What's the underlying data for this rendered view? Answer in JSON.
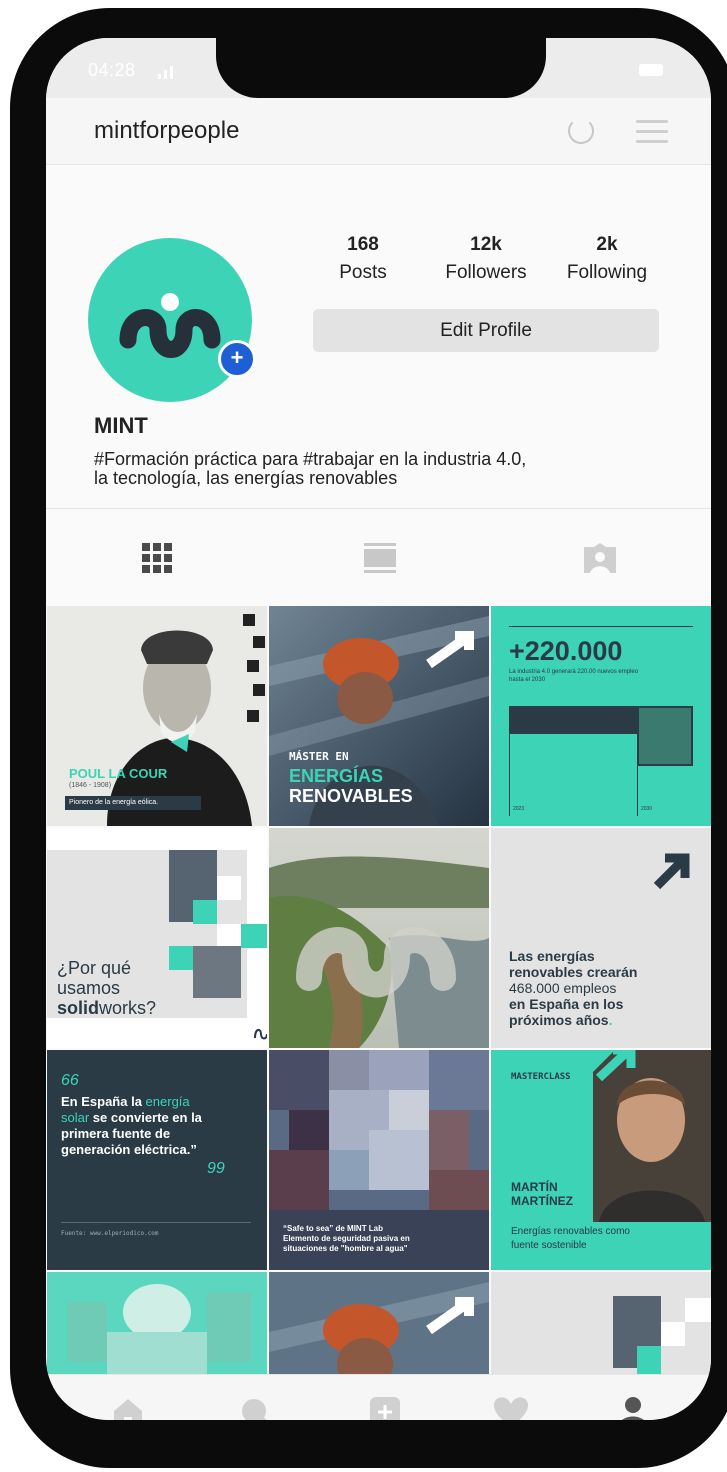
{
  "status": {
    "time": "04:28"
  },
  "header": {
    "username": "mintforpeople"
  },
  "profile": {
    "name": "MINT",
    "bio": "#Formación práctica para #trabajar en la industria 4.0, la tecnología, las energías renovables",
    "stats": [
      {
        "value": "168",
        "label": "Posts"
      },
      {
        "value": "12k",
        "label": "Followers"
      },
      {
        "value": "2k",
        "label": "Following"
      }
    ],
    "edit_label": "Edit Profile"
  },
  "tabs": [
    {
      "icon": "grid-icon"
    },
    {
      "icon": "feed-icon"
    },
    {
      "icon": "tagged-icon"
    }
  ],
  "posts": {
    "p1": {
      "title": "POUL LA COUR",
      "years": "(1846 - 1908)",
      "caption": "Pionero de la energía eólica."
    },
    "p2": {
      "line1": "MÁSTER EN",
      "line2": "ENERGÍAS",
      "line3": "RENOVABLES"
    },
    "p3": {
      "big": "+220.000",
      "small1": "La industria 4.0 generará 220.00 nuevos empleo",
      "small2": "hasta el 2030",
      "year1": "2023",
      "year2": "2030"
    },
    "p4": {
      "l1": "¿Por qué",
      "l2": "usamos",
      "l3a": "solid",
      "l3b": "works?"
    },
    "p6": {
      "l1": "Las energías",
      "l2": "renovables crearán",
      "l3": "468.000 empleos",
      "l4": "en España en los",
      "l5": "próximos años",
      "dot": "."
    },
    "p7": {
      "quote_open": "66",
      "a1": "En España la ",
      "a2": "energía",
      "b": "solar",
      "b2": " se convierte en la",
      "c": "primera fuente de",
      "d": "generación eléctrica",
      "d2": ".”",
      "quote_close": "99",
      "source": "Fuente: www.elperiodico.com"
    },
    "p8": {
      "l1": "“Safe to sea” de MINT Lab",
      "l2": "Elemento de seguridad pasiva en",
      "l3": "situaciones de \"hombre al agua\""
    },
    "p9": {
      "tag": "MASTERCLASS",
      "n1": "MARTÍN",
      "n2": "MARTÍNEZ",
      "d1": "Energías renovables como",
      "d2": "fuente sostenible"
    }
  },
  "nav": [
    {
      "icon": "home-icon"
    },
    {
      "icon": "search-icon"
    },
    {
      "icon": "add-icon"
    },
    {
      "icon": "heart-icon"
    },
    {
      "icon": "profile-icon"
    }
  ],
  "colors": {
    "accent": "#3cd3b7",
    "dark": "#2a3b46",
    "badge": "#1f5fd6"
  }
}
